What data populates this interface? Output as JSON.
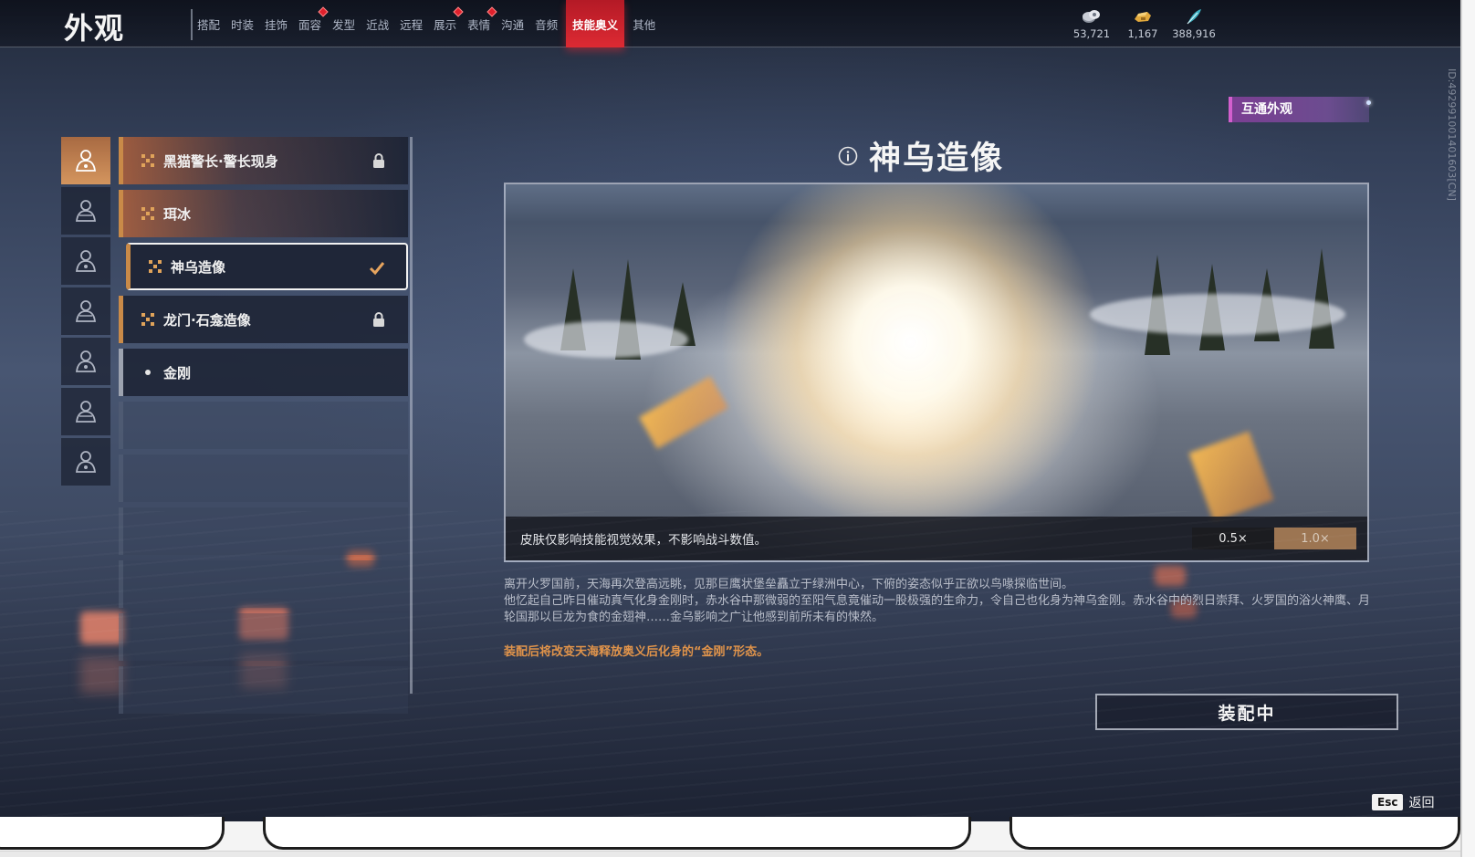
{
  "header": {
    "title": "外观",
    "tabs": [
      {
        "label": "搭配",
        "dot": false,
        "active": false
      },
      {
        "label": "时装",
        "dot": false,
        "active": false
      },
      {
        "label": "挂饰",
        "dot": false,
        "active": false
      },
      {
        "label": "面容",
        "dot": true,
        "active": false
      },
      {
        "label": "发型",
        "dot": false,
        "active": false
      },
      {
        "label": "近战",
        "dot": false,
        "active": false
      },
      {
        "label": "远程",
        "dot": false,
        "active": false
      },
      {
        "label": "展示",
        "dot": true,
        "active": false
      },
      {
        "label": "表情",
        "dot": true,
        "active": false
      },
      {
        "label": "沟通",
        "dot": false,
        "active": false
      },
      {
        "label": "音频",
        "dot": false,
        "active": false
      },
      {
        "label": "技能奥义",
        "dot": false,
        "active": true
      },
      {
        "label": "其他",
        "dot": false,
        "active": false
      }
    ],
    "currencies": [
      {
        "icon": "coin-stack-icon",
        "amount": "53,721",
        "color": "#c9cdd6"
      },
      {
        "icon": "gold-ingot-icon",
        "amount": "1,167",
        "color": "#e2a93c"
      },
      {
        "icon": "jade-feather-icon",
        "amount": "388,916",
        "color": "#3fb2c4"
      }
    ]
  },
  "side_id": "ID:492991001401603[CN]",
  "categories": [
    {
      "icon": "character-portrait-1-icon",
      "active": true
    },
    {
      "icon": "character-portrait-2-icon",
      "active": false
    },
    {
      "icon": "character-portrait-3-icon",
      "active": false
    },
    {
      "icon": "character-portrait-4-icon",
      "active": false
    },
    {
      "icon": "character-portrait-5-icon",
      "active": false
    },
    {
      "icon": "character-portrait-6-icon",
      "active": false
    },
    {
      "icon": "character-portrait-7-icon",
      "active": false
    }
  ],
  "skins": [
    {
      "name": "黑猫警长·警长现身",
      "state": "locked",
      "style": "warm"
    },
    {
      "name": "珥冰",
      "state": "none",
      "style": "warm"
    },
    {
      "name": "神乌造像",
      "state": "equipped",
      "style": "selected"
    },
    {
      "name": "龙门·石龛造像",
      "state": "locked",
      "style": "plain"
    },
    {
      "name": "金刚",
      "state": "none",
      "style": "grey"
    }
  ],
  "empty_slots": 6,
  "detail": {
    "title": "神乌造像",
    "interop_badge": "互通外观",
    "preview_note": "皮肤仅影响技能视觉效果，不影响战斗数值。",
    "speed_options": [
      "0.5×",
      "1.0×"
    ],
    "speed_selected": "0.5×",
    "description_line1": "离开火罗国前，天海再次登高远眺，见那巨鹰状堡垒矗立于绿洲中心，下俯的姿态似乎正欲以鸟喙探临世间。",
    "description_line2": "他忆起自己昨日催动真气化身金刚时，赤水谷中那微弱的至阳气息竟催动一股极强的生命力，令自己也化身为神乌金刚。赤水谷中的烈日崇拜、火罗国的浴火神鹰、月轮国那以巨龙为食的金翅神……金乌影响之广让他感到前所未有的悚然。",
    "equip_note": "装配后将改变天海释放奥义后化身的“金刚”形态。",
    "equip_button": "装配中"
  },
  "footer": {
    "esc_key": "Esc",
    "esc_label": "返回"
  }
}
